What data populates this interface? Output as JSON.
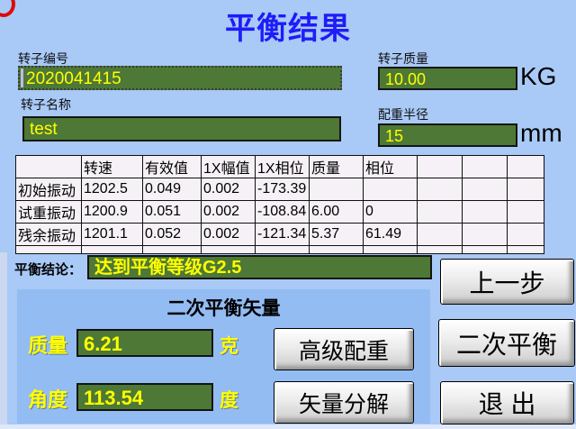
{
  "window": {
    "title": "平衡结果"
  },
  "fields": {
    "rotor_id": {
      "label": "转子编号",
      "value": "2020041415"
    },
    "rotor_mass": {
      "label": "转子质量",
      "value": "10.00",
      "unit": "KG"
    },
    "rotor_name": {
      "label": "转子名称",
      "value": "test"
    },
    "weight_radius": {
      "label": "配重半径",
      "value": "15",
      "unit": "mm"
    }
  },
  "table": {
    "headers": [
      "",
      "转速",
      "有效值",
      "1X幅值",
      "1X相位",
      "质量",
      "相位",
      "",
      "",
      ""
    ],
    "rows": [
      {
        "label": "初始振动",
        "cells": [
          "1202.5",
          "0.049",
          "0.002",
          "-173.39",
          "",
          "",
          "",
          "",
          ""
        ]
      },
      {
        "label": "试重振动",
        "cells": [
          "1200.9",
          "0.051",
          "0.002",
          "-108.84",
          "6.00",
          "0",
          "",
          "",
          ""
        ]
      },
      {
        "label": "残余振动",
        "cells": [
          "1201.1",
          "0.052",
          "0.002",
          "-121.34",
          "5.37",
          "61.49",
          "",
          "",
          ""
        ]
      }
    ]
  },
  "conclusion": {
    "label": "平衡结论：",
    "value": "达到平衡等级G2.5"
  },
  "vector_panel": {
    "title": "二次平衡矢量",
    "mass": {
      "label": "质量",
      "value": "6.21",
      "unit": "克"
    },
    "angle": {
      "label": "角度",
      "value": "113.54",
      "unit": "度"
    },
    "advanced_weight_button": "高级配重",
    "vector_decompose_button": "矢量分解"
  },
  "buttons": {
    "prev_step": "上一步",
    "secondary_balance": "二次平衡",
    "exit": "退  出"
  },
  "colors": {
    "background": "#a9c9f6",
    "panel_background": "#93bcf3",
    "field_green": "#4d7836",
    "value_yellow": "#ffff00",
    "title_blue": "#1f1cf8",
    "table_background": "#f6f1f6",
    "button_face": "#e0e0e0",
    "accent_red": "#dd0a0a"
  }
}
